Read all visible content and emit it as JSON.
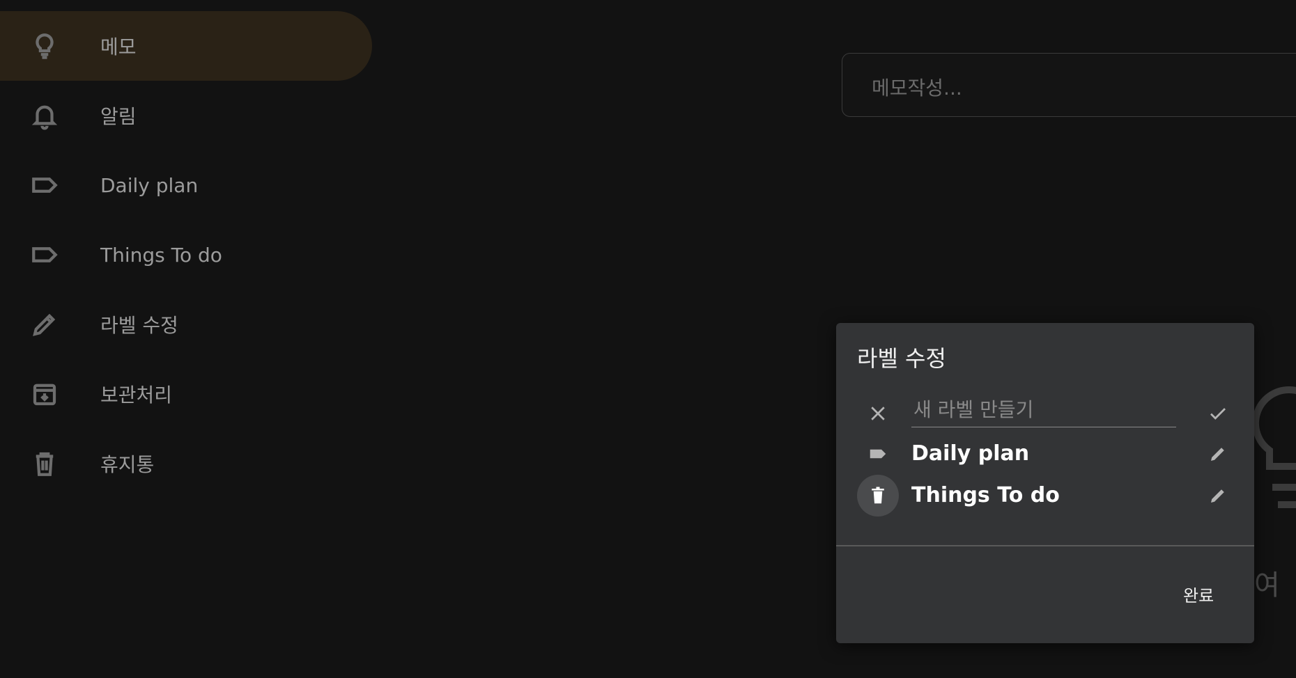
{
  "sidebar": {
    "items": [
      {
        "label": "메모",
        "icon": "lightbulb-icon",
        "active": true
      },
      {
        "label": "알림",
        "icon": "bell-icon"
      },
      {
        "label": "Daily plan",
        "icon": "label-icon"
      },
      {
        "label": "Things To do",
        "icon": "label-icon"
      },
      {
        "label": "라벨 수정",
        "icon": "pencil-icon"
      },
      {
        "label": "보관처리",
        "icon": "archive-icon"
      },
      {
        "label": "휴지통",
        "icon": "trash-icon"
      }
    ]
  },
  "main": {
    "search_placeholder": "메모작성...",
    "background_text": "여"
  },
  "dialog": {
    "title": "라벨 수정",
    "new_label_placeholder": "새 라벨 만들기",
    "labels": [
      {
        "name": "Daily plan"
      },
      {
        "name": "Things To do"
      }
    ],
    "done_label": "완료"
  },
  "colors": {
    "background": "#161616",
    "active_nav": "#2a2216",
    "dialog": "#333436"
  }
}
